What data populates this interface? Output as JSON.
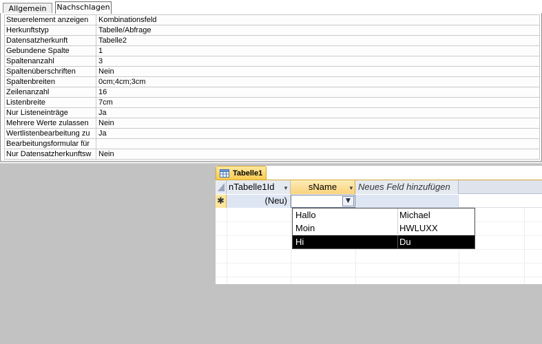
{
  "tabs": [
    {
      "label": "Allgemein",
      "active": false
    },
    {
      "label": "Nachschlagen",
      "active": true
    }
  ],
  "properties": [
    {
      "name": "Steuerelement anzeigen",
      "value": "Kombinationsfeld"
    },
    {
      "name": "Herkunftstyp",
      "value": "Tabelle/Abfrage"
    },
    {
      "name": "Datensatzherkunft",
      "value": "Tabelle2"
    },
    {
      "name": "Gebundene Spalte",
      "value": "1"
    },
    {
      "name": "Spaltenanzahl",
      "value": "3"
    },
    {
      "name": "Spaltenüberschriften",
      "value": "Nein"
    },
    {
      "name": "Spaltenbreiten",
      "value": "0cm;4cm;3cm"
    },
    {
      "name": "Zeilenanzahl",
      "value": "16"
    },
    {
      "name": "Listenbreite",
      "value": "7cm"
    },
    {
      "name": "Nur Listeneinträge",
      "value": "Ja"
    },
    {
      "name": "Mehrere Werte zulassen",
      "value": "Nein"
    },
    {
      "name": "Wertlistenbearbeitung zu",
      "value": "Ja"
    },
    {
      "name": "Bearbeitungsformular für",
      "value": ""
    },
    {
      "name": "Nur Datensatzherkunftsw",
      "value": "Nein"
    }
  ],
  "table": {
    "title": "Tabelle1",
    "columns": [
      "nTabelle1Id",
      "sName",
      "Neues Feld hinzufügen"
    ],
    "new_row": {
      "marker": "✱",
      "id_value": "(Neu)"
    }
  },
  "dropdown": {
    "rows": [
      {
        "col1": "Hallo",
        "col2": "Michael",
        "selected": false
      },
      {
        "col1": "Moin",
        "col2": "HWLUXX",
        "selected": false
      },
      {
        "col1": "Hi",
        "col2": "Du",
        "selected": true
      }
    ]
  },
  "icons": {
    "table_icon": "table-icon",
    "combo_arrow": "chevron-down-icon",
    "column_sort": "dropdown-arrow-icon",
    "new_record": "asterisk-icon"
  },
  "colors": {
    "accent_tab": "#f9c94a",
    "selection": "#000000",
    "workspace": "#c2c2c2"
  }
}
